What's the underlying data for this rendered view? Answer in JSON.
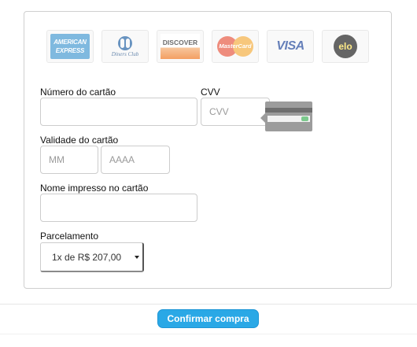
{
  "card_brands": [
    {
      "name": "American Express",
      "icon": "amex-icon",
      "logo_text": [
        "AMERICAN",
        "EXPRESS"
      ]
    },
    {
      "name": "Diners Club",
      "icon": "diners-club-icon",
      "logo_text": "Diners Club"
    },
    {
      "name": "Discover",
      "icon": "discover-icon",
      "logo_text": "DISCOVER"
    },
    {
      "name": "MasterCard",
      "icon": "mastercard-icon",
      "logo_text": "MasterCard"
    },
    {
      "name": "Visa",
      "icon": "visa-icon",
      "logo_text": "VISA"
    },
    {
      "name": "Elo",
      "icon": "elo-icon",
      "logo_text": "elo"
    }
  ],
  "form": {
    "card_number": {
      "label": "Número do cartão",
      "value": "",
      "placeholder": ""
    },
    "cvv": {
      "label": "CVV",
      "value": "",
      "placeholder": "CVV"
    },
    "expiry": {
      "label": "Validade do cartão",
      "month": {
        "value": "",
        "placeholder": "MM"
      },
      "year": {
        "value": "",
        "placeholder": "AAAA"
      }
    },
    "cardholder_name": {
      "label": "Nome impresso no cartão",
      "value": "",
      "placeholder": ""
    },
    "installments": {
      "label": "Parcelamento",
      "selected": "1x de R$ 207,00"
    }
  },
  "actions": {
    "confirm_label": "Confirmar compra"
  },
  "colors": {
    "primary_button": "#2aa8e6",
    "panel_border": "#cfcfcf"
  }
}
